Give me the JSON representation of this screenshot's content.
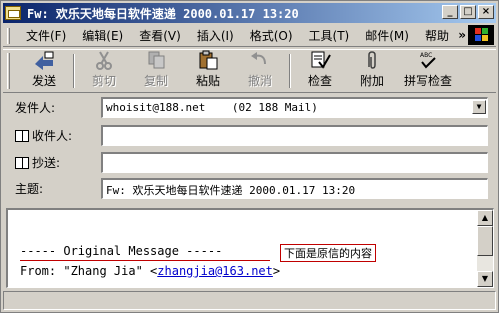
{
  "window": {
    "title": "Fw: 欢乐天地每日软件速递 2000.01.17 13:20"
  },
  "menu": [
    "文件(F)",
    "编辑(E)",
    "查看(V)",
    "插入(I)",
    "格式(O)",
    "工具(T)",
    "邮件(M)",
    "帮助"
  ],
  "menu_more": "»",
  "toolbar": [
    {
      "label": "发送",
      "icon": "send-icon",
      "enabled": true
    },
    {
      "label": "剪切",
      "icon": "scissors-icon",
      "enabled": false
    },
    {
      "label": "复制",
      "icon": "copy-icon",
      "enabled": false
    },
    {
      "label": "粘贴",
      "icon": "paste-icon",
      "enabled": true
    },
    {
      "label": "撤消",
      "icon": "undo-icon",
      "enabled": false
    },
    {
      "label": "检查",
      "icon": "check-names-icon",
      "enabled": true
    },
    {
      "label": "附加",
      "icon": "paperclip-icon",
      "enabled": true
    },
    {
      "label": "拼写检查",
      "icon": "spellcheck-icon",
      "enabled": true
    }
  ],
  "fields": {
    "from_label": "发件人:",
    "from_value": "whoisit@188.net    (02 188 Mail)",
    "to_label": "收件人:",
    "to_value": "",
    "cc_label": "抄送:",
    "cc_value": "",
    "subject_label": "主题:",
    "subject_value": "Fw: 欢乐天地每日软件速递 2000.01.17 13:20"
  },
  "body": {
    "original_line": "----- Original Message -----",
    "annotation": "下面是原信的内容",
    "from_prefix": "From: \"Zhang Jia\" <",
    "from_email": "zhangjia@163.net",
    "from_suffix": ">"
  },
  "colors": {
    "title_start": "#0a246a",
    "title_end": "#a6caf0",
    "annotation_border": "#c00000",
    "link": "#0000cc"
  }
}
